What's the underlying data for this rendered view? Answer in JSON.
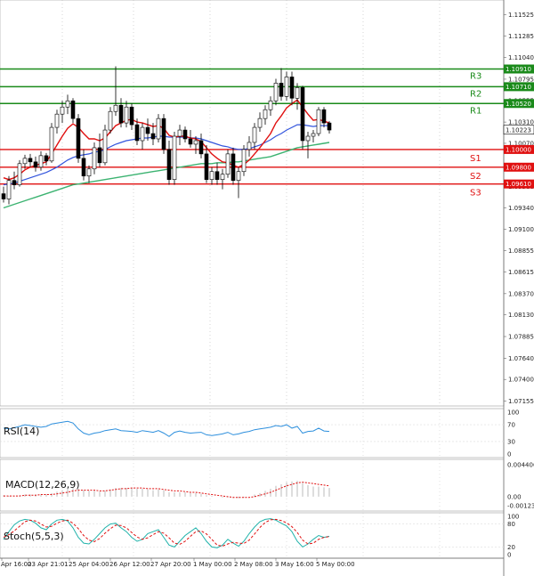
{
  "chart_data": {
    "type": "candlestick",
    "price_axis": {
      "ticks": [
        "1.11525",
        "1.11285",
        "1.11040",
        "1.10795",
        "1.10555",
        "1.10310",
        "1.10070",
        "1.09825",
        "1.09580",
        "1.09340",
        "1.09100",
        "1.08855",
        "1.08615",
        "1.08370",
        "1.08130",
        "1.07885",
        "1.07640",
        "1.07400",
        "1.07155"
      ],
      "range": [
        1.071,
        1.1165
      ]
    },
    "time_axis": {
      "labels": [
        "Apr 16:00",
        "23 Apr 21:01",
        "25 Apr 04:00",
        "26 Apr 12:00",
        "27 Apr 20:00",
        "1 May 00:00",
        "2 May 08:00",
        "3 May 16:00",
        "5 May 00:00"
      ]
    },
    "levels": [
      {
        "name": "R3",
        "value": 1.1091,
        "label": "1.10910",
        "color": "#1a8a1a"
      },
      {
        "name": "R2",
        "value": 1.1071,
        "label": "1.10710",
        "color": "#1a8a1a"
      },
      {
        "name": "R1",
        "value": 1.1052,
        "label": "1.10520",
        "color": "#1a8a1a"
      },
      {
        "name": "",
        "value": 1.1,
        "label": "1.10000",
        "color": "#e01010"
      },
      {
        "name": "S1",
        "value": 1.1,
        "label": "",
        "color": "#e01010"
      },
      {
        "name": "S2",
        "value": 1.098,
        "label": "1.09800",
        "color": "#e01010"
      },
      {
        "name": "S3",
        "value": 1.0961,
        "label": "1.09610",
        "color": "#e01010"
      }
    ],
    "current_price": {
      "value": 1.10223,
      "label": "1.10223"
    },
    "candles": [
      [
        1.095,
        1.0958,
        1.094,
        1.0944
      ],
      [
        1.0944,
        1.097,
        1.0938,
        1.0965
      ],
      [
        1.0965,
        1.0975,
        1.0955,
        1.096
      ],
      [
        1.096,
        1.0988,
        1.0958,
        1.0984
      ],
      [
        1.0984,
        1.0994,
        1.0978,
        1.099
      ],
      [
        1.099,
        1.0995,
        1.098,
        1.0986
      ],
      [
        1.0986,
        1.0992,
        1.0975,
        1.098
      ],
      [
        1.098,
        1.0998,
        1.0976,
        1.0993
      ],
      [
        1.0993,
        1.0996,
        1.0982,
        1.0987
      ],
      [
        1.0987,
        1.103,
        1.0985,
        1.1025
      ],
      [
        1.1025,
        1.1045,
        1.1018,
        1.104
      ],
      [
        1.104,
        1.1055,
        1.103,
        1.1048
      ],
      [
        1.1048,
        1.1062,
        1.104,
        1.1055
      ],
      [
        1.1055,
        1.1058,
        1.103,
        1.1035
      ],
      [
        1.1035,
        1.104,
        1.0985,
        1.099
      ],
      [
        1.099,
        1.1,
        1.0965,
        1.097
      ],
      [
        1.097,
        1.0982,
        1.0962,
        1.0978
      ],
      [
        1.0978,
        1.1008,
        1.0972,
        1.1002
      ],
      [
        1.1002,
        1.1018,
        1.098,
        1.0985
      ],
      [
        1.0985,
        1.1028,
        1.0982,
        1.1022
      ],
      [
        1.1022,
        1.1048,
        1.1018,
        1.1043
      ],
      [
        1.1043,
        1.1094,
        1.1038,
        1.105
      ],
      [
        1.105,
        1.1058,
        1.1025,
        1.103
      ],
      [
        1.103,
        1.1055,
        1.1025,
        1.1048
      ],
      [
        1.1048,
        1.1052,
        1.1022,
        1.1028
      ],
      [
        1.1028,
        1.1035,
        1.1005,
        1.101
      ],
      [
        1.101,
        1.103,
        1.1,
        1.1025
      ],
      [
        1.1025,
        1.1035,
        1.101,
        1.1018
      ],
      [
        1.1018,
        1.103,
        1.1005,
        1.1012
      ],
      [
        1.1012,
        1.104,
        1.1008,
        1.1035
      ],
      [
        1.1035,
        1.104,
        1.0995,
        1.1
      ],
      [
        1.1,
        1.101,
        1.096,
        1.0966
      ],
      [
        1.0966,
        1.102,
        1.096,
        1.1015
      ],
      [
        1.1015,
        1.1028,
        1.1005,
        1.1022
      ],
      [
        1.1022,
        1.1026,
        1.1008,
        1.1012
      ],
      [
        1.1012,
        1.1022,
        1.1002,
        1.1006
      ],
      [
        1.1006,
        1.1015,
        1.0995,
        1.101
      ],
      [
        1.101,
        1.1018,
        1.099,
        1.0995
      ],
      [
        1.0995,
        1.1005,
        1.0962,
        1.0966
      ],
      [
        1.0966,
        1.098,
        1.096,
        1.0975
      ],
      [
        1.0975,
        1.0985,
        1.096,
        1.0966
      ],
      [
        1.0966,
        1.0978,
        1.0955,
        1.0972
      ],
      [
        1.0972,
        1.1,
        1.0968,
        1.0995
      ],
      [
        1.0995,
        1.1002,
        1.096,
        1.0965
      ],
      [
        1.0965,
        1.098,
        1.0945,
        1.0975
      ],
      [
        1.0975,
        1.1005,
        1.097,
        1.1
      ],
      [
        1.1,
        1.1015,
        1.0992,
        1.1008
      ],
      [
        1.1008,
        1.103,
        1.1,
        1.1025
      ],
      [
        1.1025,
        1.1042,
        1.102,
        1.1035
      ],
      [
        1.1035,
        1.105,
        1.1028,
        1.1045
      ],
      [
        1.1045,
        1.106,
        1.1038,
        1.1055
      ],
      [
        1.1055,
        1.108,
        1.105,
        1.1075
      ],
      [
        1.1075,
        1.1092,
        1.1055,
        1.106
      ],
      [
        1.106,
        1.1088,
        1.1055,
        1.1082
      ],
      [
        1.1082,
        1.1088,
        1.105,
        1.1058
      ],
      [
        1.1058,
        1.1075,
        1.1045,
        1.107
      ],
      [
        1.107,
        1.1072,
        1.1,
        1.101
      ],
      [
        1.101,
        1.102,
        1.099,
        1.1015
      ],
      [
        1.1015,
        1.1022,
        1.1008,
        1.1018
      ],
      [
        1.1018,
        1.1048,
        1.1015,
        1.1045
      ],
      [
        1.1045,
        1.1048,
        1.1025,
        1.103
      ],
      [
        1.103,
        1.1032,
        1.1018,
        1.1022
      ]
    ],
    "ma_fast": [
      1.0968,
      1.0966,
      1.0968,
      1.0972,
      1.0977,
      1.098,
      1.0982,
      1.0984,
      1.0986,
      1.0995,
      1.1005,
      1.1015,
      1.1024,
      1.1029,
      1.1025,
      1.1018,
      1.1012,
      1.1012,
      1.101,
      1.1013,
      1.102,
      1.1027,
      1.103,
      1.1033,
      1.1034,
      1.1031,
      1.103,
      1.1028,
      1.1026,
      1.1027,
      1.1024,
      1.1016,
      1.1014,
      1.1015,
      1.1015,
      1.1013,
      1.1012,
      1.1009,
      1.1002,
      1.0995,
      1.099,
      1.0986,
      1.0985,
      1.0982,
      1.098,
      1.0983,
      1.0988,
      1.0995,
      1.1002,
      1.101,
      1.1018,
      1.103,
      1.1038,
      1.1047,
      1.1052,
      1.1056,
      1.1048,
      1.104,
      1.1033,
      1.1034,
      1.1032,
      1.103
    ],
    "ma_mid": [
      1.096,
      1.0961,
      1.0962,
      1.0964,
      1.0966,
      1.0968,
      1.097,
      1.0972,
      1.0974,
      1.0977,
      1.098,
      1.0984,
      1.0988,
      1.0991,
      1.0993,
      1.0994,
      1.0995,
      1.0997,
      1.0998,
      1.1,
      1.1003,
      1.1006,
      1.1008,
      1.101,
      1.1011,
      1.1012,
      1.1013,
      1.1013,
      1.1014,
      1.1015,
      1.1015,
      1.1014,
      1.1014,
      1.1014,
      1.1014,
      1.1013,
      1.1013,
      1.1012,
      1.101,
      1.1008,
      1.1006,
      1.1004,
      1.1003,
      1.1001,
      1.1,
      1.1,
      1.1001,
      1.1003,
      1.1005,
      1.1008,
      1.1011,
      1.1015,
      1.1018,
      1.1022,
      1.1025,
      1.1028,
      1.1028,
      1.1027,
      1.1026,
      1.1027,
      1.1027,
      1.1027
    ],
    "ma_slow": [
      1.0934,
      1.0936,
      1.0938,
      1.094,
      1.0942,
      1.0944,
      1.0946,
      1.0948,
      1.095,
      1.0952,
      1.0954,
      1.0956,
      1.0958,
      1.096,
      1.0961,
      1.0962,
      1.0963,
      1.0964,
      1.0965,
      1.0966,
      1.0967,
      1.0968,
      1.0969,
      1.097,
      1.0971,
      1.0972,
      1.0973,
      1.0974,
      1.0975,
      1.0976,
      1.0977,
      1.0978,
      1.0979,
      1.098,
      1.0981,
      1.0982,
      1.0983,
      1.0984,
      1.0984,
      1.0984,
      1.0985,
      1.0985,
      1.0985,
      1.0986,
      1.0986,
      1.0987,
      1.0988,
      1.0989,
      1.099,
      1.0991,
      1.0992,
      1.0994,
      1.0996,
      1.0998,
      1.1,
      1.1002,
      1.1003,
      1.1004,
      1.1005,
      1.1006,
      1.1007,
      1.1008
    ],
    "rsi": {
      "name": "RSI(14)",
      "axis_labels": [
        "100",
        "70",
        "30",
        "0"
      ],
      "range": [
        0,
        100
      ],
      "values": [
        62,
        60,
        63,
        66,
        70,
        68,
        66,
        64,
        66,
        72,
        74,
        76,
        78,
        74,
        60,
        50,
        46,
        50,
        52,
        56,
        58,
        60,
        56,
        55,
        54,
        52,
        56,
        54,
        52,
        56,
        50,
        42,
        52,
        55,
        52,
        50,
        51,
        52,
        46,
        44,
        46,
        48,
        52,
        46,
        48,
        52,
        54,
        58,
        60,
        62,
        64,
        68,
        66,
        70,
        62,
        66,
        50,
        54,
        55,
        62,
        55,
        54
      ]
    },
    "macd": {
      "name": "MACD(12,26,9)",
      "axis_labels": [
        "0.004406",
        "0.00",
        "-0.001237"
      ],
      "range": [
        -0.001237,
        0.004406
      ],
      "histogram": [
        0.0002,
        0.0001,
        0.0001,
        0.0002,
        0.0003,
        0.0003,
        0.0003,
        0.0003,
        0.0003,
        0.0005,
        0.0007,
        0.0009,
        0.0011,
        0.0012,
        0.0011,
        0.0009,
        0.0008,
        0.0008,
        0.0007,
        0.0008,
        0.001,
        0.0012,
        0.0012,
        0.0012,
        0.0012,
        0.0011,
        0.0011,
        0.001,
        0.0009,
        0.001,
        0.0009,
        0.0006,
        0.0006,
        0.0006,
        0.0006,
        0.0005,
        0.0005,
        0.0004,
        0.0002,
        0.0001,
        0.0,
        -0.0001,
        -0.0001,
        -0.0002,
        -0.0002,
        -0.0001,
        0.0,
        0.0003,
        0.0005,
        0.0008,
        0.0011,
        0.0015,
        0.0017,
        0.002,
        0.0021,
        0.0022,
        0.0019,
        0.0016,
        0.0014,
        0.0014,
        0.0013,
        0.0012
      ],
      "signal": [
        0.0001,
        0.0001,
        0.0001,
        0.0001,
        0.0002,
        0.0002,
        0.0002,
        0.0003,
        0.0003,
        0.0003,
        0.0004,
        0.0005,
        0.0006,
        0.0008,
        0.0009,
        0.0009,
        0.0009,
        0.0009,
        0.0008,
        0.0008,
        0.0009,
        0.001,
        0.0011,
        0.0011,
        0.0012,
        0.0012,
        0.0012,
        0.0011,
        0.0011,
        0.0011,
        0.001,
        0.0009,
        0.0008,
        0.0008,
        0.0007,
        0.0006,
        0.0006,
        0.0005,
        0.0004,
        0.0003,
        0.0002,
        0.0001,
        0.0,
        -0.0001,
        -0.0001,
        -0.0001,
        -0.0001,
        0.0,
        0.0002,
        0.0004,
        0.0006,
        0.0009,
        0.0012,
        0.0015,
        0.0017,
        0.0019,
        0.002,
        0.0019,
        0.0018,
        0.0017,
        0.0016,
        0.0015
      ]
    },
    "stoch": {
      "name": "Stoch(5,5,3)",
      "axis_labels": [
        "100",
        "80",
        "20",
        "0"
      ],
      "range": [
        0,
        100
      ],
      "k": [
        40,
        60,
        78,
        88,
        92,
        90,
        82,
        70,
        65,
        80,
        90,
        92,
        88,
        70,
        45,
        30,
        28,
        40,
        55,
        70,
        80,
        82,
        70,
        60,
        45,
        35,
        40,
        55,
        60,
        65,
        45,
        25,
        20,
        35,
        50,
        60,
        70,
        55,
        35,
        20,
        18,
        25,
        40,
        30,
        22,
        35,
        55,
        72,
        86,
        92,
        94,
        90,
        82,
        75,
        60,
        35,
        20,
        28,
        40,
        50,
        45,
        48
      ],
      "d": [
        45,
        52,
        62,
        74,
        86,
        90,
        88,
        80,
        72,
        74,
        82,
        88,
        90,
        82,
        68,
        50,
        38,
        34,
        42,
        56,
        68,
        77,
        76,
        70,
        58,
        46,
        40,
        44,
        52,
        60,
        56,
        44,
        30,
        27,
        35,
        48,
        60,
        62,
        54,
        40,
        25,
        22,
        28,
        32,
        30,
        29,
        38,
        54,
        71,
        84,
        91,
        92,
        89,
        83,
        73,
        58,
        38,
        28,
        30,
        40,
        45,
        47
      ]
    }
  }
}
